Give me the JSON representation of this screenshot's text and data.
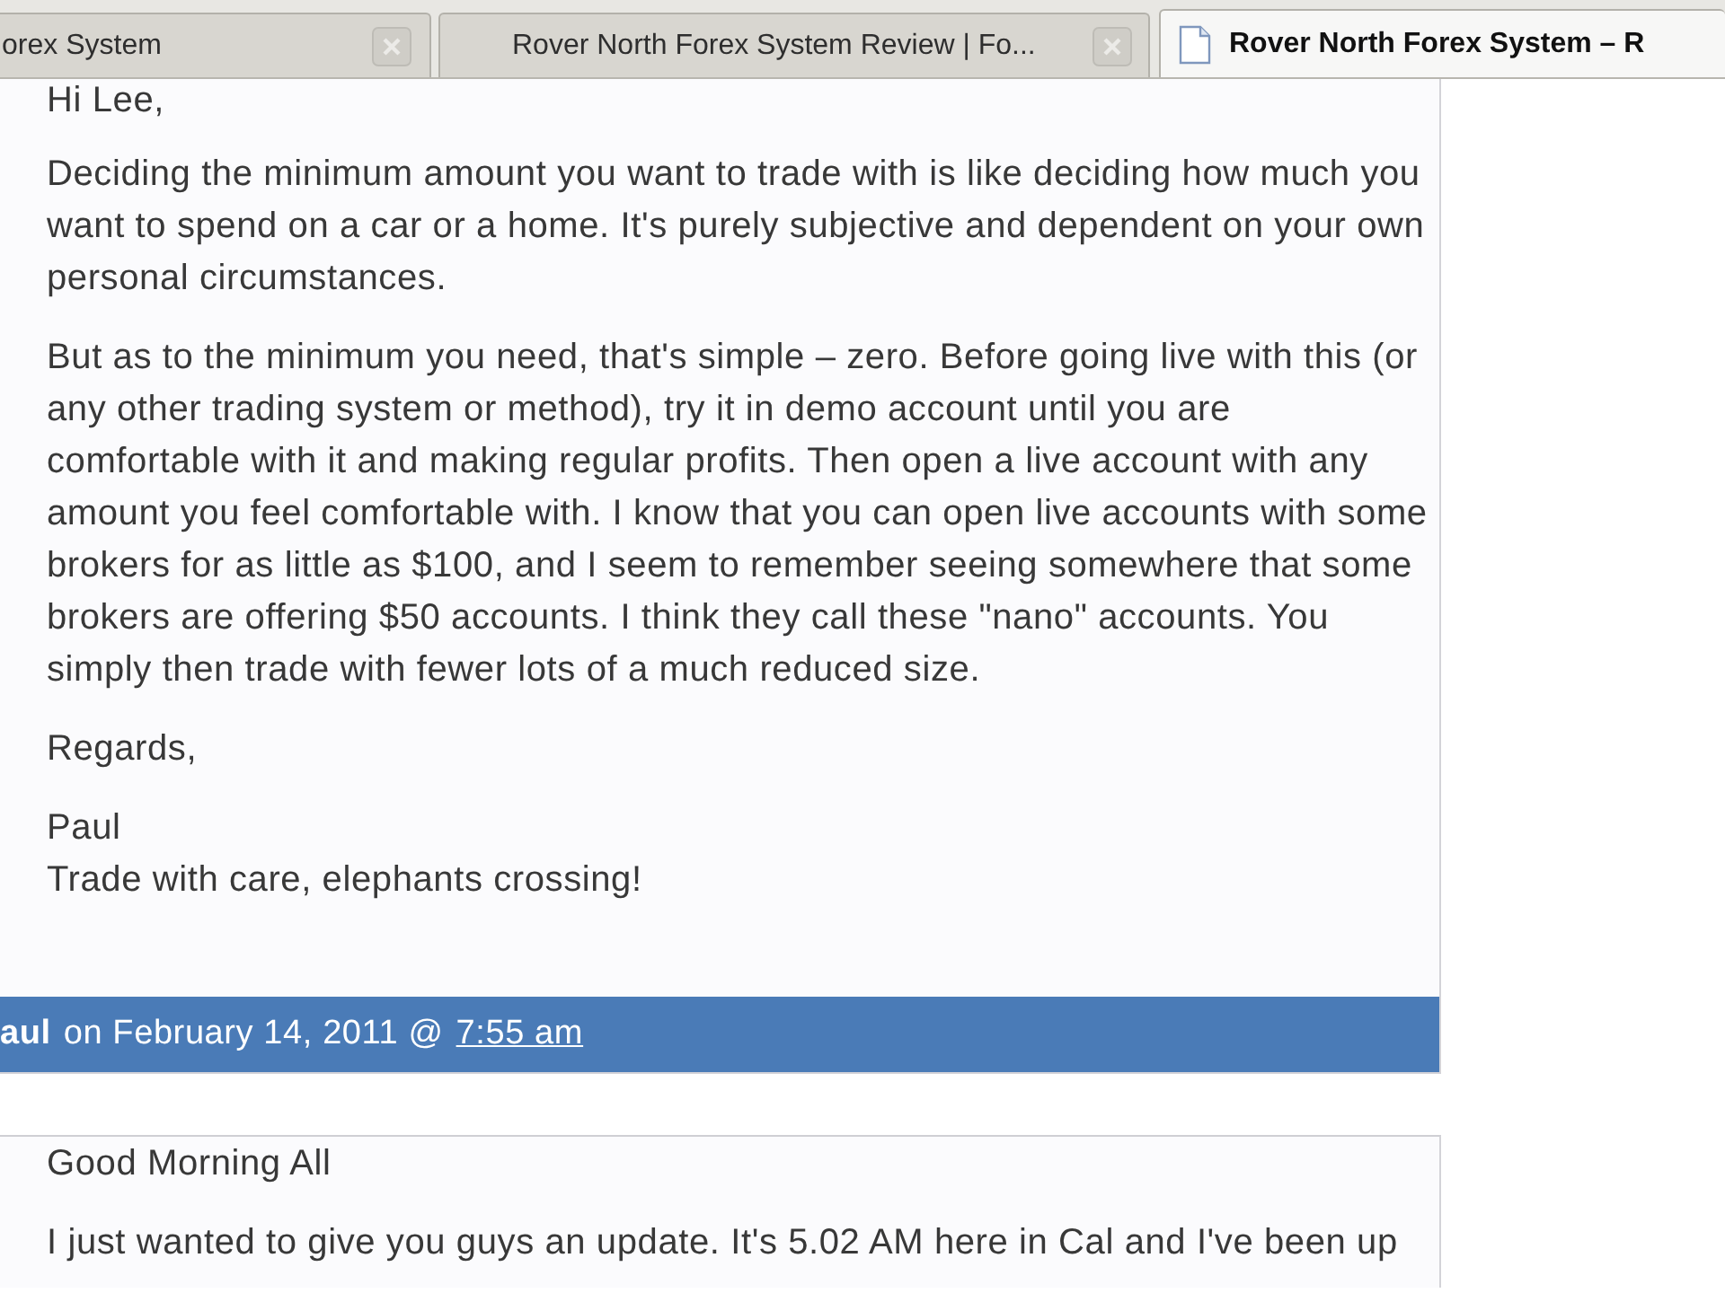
{
  "tabs": [
    {
      "title": "orex System",
      "selected": false
    },
    {
      "title": "Rover North Forex System Review | Fo...",
      "selected": false
    },
    {
      "title": "Rover North Forex System – R",
      "selected": true
    }
  ],
  "comments": [
    {
      "paragraphs": [
        [
          "Hi Lee,"
        ],
        [
          "Deciding the minimum amount you want to trade with is like deciding how much you",
          "want to spend on a car or a home. It's purely subjective and dependent on your own",
          "personal circumstances."
        ],
        [
          "But as to the minimum you need, that's simple – zero. Before going live with this (or",
          "any other trading system or method), try it in demo account until you are",
          "comfortable with it and making regular profits. Then open a live account with any",
          "amount you feel comfortable with. I know that you can open live accounts with some",
          "brokers for as little as $100, and I seem to remember seeing somewhere that some",
          "brokers are offering $50 accounts. I think they call these \"nano\" accounts. You",
          "simply then trade with fewer lots of a much reduced size."
        ],
        [
          "Regards,"
        ],
        [
          "Paul",
          "Trade with care, elephants crossing!"
        ]
      ],
      "footer": {
        "author": "aul",
        "date": "on February 14, 2011 @",
        "time": "7:55 am"
      }
    },
    {
      "paragraphs": [
        [
          "Good Morning All"
        ],
        [
          "I just wanted to give you guys an update. It's 5.02 AM here in Cal and I've been up"
        ]
      ]
    }
  ]
}
